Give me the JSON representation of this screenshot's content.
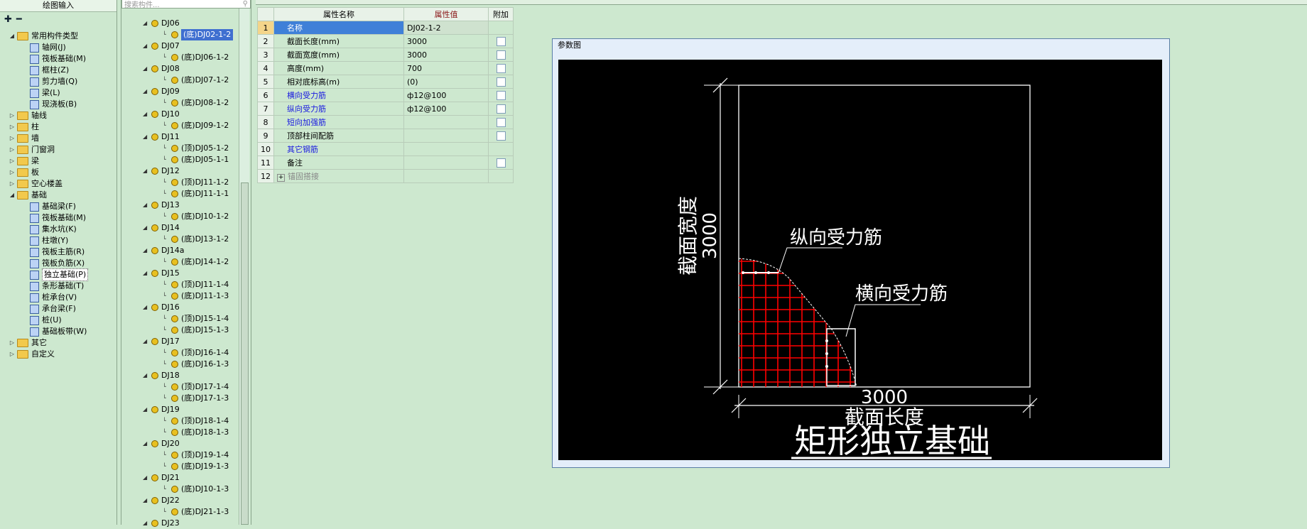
{
  "left": {
    "title": "绘图输入",
    "tree": [
      {
        "level": 0,
        "exp": "◢",
        "type": "folder",
        "label": "常用构件类型"
      },
      {
        "level": 1,
        "type": "icon",
        "label": "轴网(J)"
      },
      {
        "level": 1,
        "type": "icon",
        "label": "筏板基础(M)"
      },
      {
        "level": 1,
        "type": "icon",
        "label": "框柱(Z)"
      },
      {
        "level": 1,
        "type": "icon",
        "label": "剪力墙(Q)"
      },
      {
        "level": 1,
        "type": "icon",
        "label": "梁(L)"
      },
      {
        "level": 1,
        "type": "icon",
        "label": "现浇板(B)"
      },
      {
        "level": 0,
        "exp": "▷",
        "type": "folder",
        "label": "轴线"
      },
      {
        "level": 0,
        "exp": "▷",
        "type": "folder",
        "label": "柱"
      },
      {
        "level": 0,
        "exp": "▷",
        "type": "folder",
        "label": "墙"
      },
      {
        "level": 0,
        "exp": "▷",
        "type": "folder",
        "label": "门窗洞"
      },
      {
        "level": 0,
        "exp": "▷",
        "type": "folder",
        "label": "梁"
      },
      {
        "level": 0,
        "exp": "▷",
        "type": "folder",
        "label": "板"
      },
      {
        "level": 0,
        "exp": "▷",
        "type": "folder",
        "label": "空心楼盖"
      },
      {
        "level": 0,
        "exp": "◢",
        "type": "folder",
        "label": "基础"
      },
      {
        "level": 1,
        "type": "icon",
        "label": "基础梁(F)"
      },
      {
        "level": 1,
        "type": "icon",
        "label": "筏板基础(M)"
      },
      {
        "level": 1,
        "type": "icon",
        "label": "集水坑(K)"
      },
      {
        "level": 1,
        "type": "icon",
        "label": "柱墩(Y)"
      },
      {
        "level": 1,
        "type": "icon",
        "label": "筏板主筋(R)"
      },
      {
        "level": 1,
        "type": "icon",
        "label": "筏板负筋(X)"
      },
      {
        "level": 1,
        "type": "icon",
        "label": "独立基础(P)",
        "selected": true
      },
      {
        "level": 1,
        "type": "icon",
        "label": "条形基础(T)"
      },
      {
        "level": 1,
        "type": "icon",
        "label": "桩承台(V)"
      },
      {
        "level": 1,
        "type": "icon",
        "label": "承台梁(F)"
      },
      {
        "level": 1,
        "type": "icon",
        "label": "桩(U)"
      },
      {
        "level": 1,
        "type": "icon",
        "label": "基础板带(W)"
      },
      {
        "level": 0,
        "exp": "▷",
        "type": "folder",
        "label": "其它"
      },
      {
        "level": 0,
        "exp": "▷",
        "type": "folder",
        "label": "自定义"
      }
    ]
  },
  "middle": {
    "search_placeholder": "搜索构件...",
    "items": [
      {
        "level": 0,
        "label": "DJ06"
      },
      {
        "level": 1,
        "label": "(底)DJ02-1-2",
        "selected": true
      },
      {
        "level": 0,
        "label": "DJ07"
      },
      {
        "level": 1,
        "label": "(底)DJ06-1-2"
      },
      {
        "level": 0,
        "label": "DJ08"
      },
      {
        "level": 1,
        "label": "(底)DJ07-1-2"
      },
      {
        "level": 0,
        "label": "DJ09"
      },
      {
        "level": 1,
        "label": "(底)DJ08-1-2"
      },
      {
        "level": 0,
        "label": "DJ10"
      },
      {
        "level": 1,
        "label": "(底)DJ09-1-2"
      },
      {
        "level": 0,
        "label": "DJ11"
      },
      {
        "level": 1,
        "label": "(顶)DJ05-1-2"
      },
      {
        "level": 1,
        "label": "(底)DJ05-1-1"
      },
      {
        "level": 0,
        "label": "DJ12"
      },
      {
        "level": 1,
        "label": "(顶)DJ11-1-2"
      },
      {
        "level": 1,
        "label": "(底)DJ11-1-1"
      },
      {
        "level": 0,
        "label": "DJ13"
      },
      {
        "level": 1,
        "label": "(底)DJ10-1-2"
      },
      {
        "level": 0,
        "label": "DJ14"
      },
      {
        "level": 1,
        "label": "(底)DJ13-1-2"
      },
      {
        "level": 0,
        "label": "DJ14a"
      },
      {
        "level": 1,
        "label": "(底)DJ14-1-2"
      },
      {
        "level": 0,
        "label": "DJ15"
      },
      {
        "level": 1,
        "label": "(顶)DJ11-1-4"
      },
      {
        "level": 1,
        "label": "(底)DJ11-1-3"
      },
      {
        "level": 0,
        "label": "DJ16"
      },
      {
        "level": 1,
        "label": "(顶)DJ15-1-4"
      },
      {
        "level": 1,
        "label": "(底)DJ15-1-3"
      },
      {
        "level": 0,
        "label": "DJ17"
      },
      {
        "level": 1,
        "label": "(顶)DJ16-1-4"
      },
      {
        "level": 1,
        "label": "(底)DJ16-1-3"
      },
      {
        "level": 0,
        "label": "DJ18"
      },
      {
        "level": 1,
        "label": "(顶)DJ17-1-4"
      },
      {
        "level": 1,
        "label": "(底)DJ17-1-3"
      },
      {
        "level": 0,
        "label": "DJ19"
      },
      {
        "level": 1,
        "label": "(顶)DJ18-1-4"
      },
      {
        "level": 1,
        "label": "(底)DJ18-1-3"
      },
      {
        "level": 0,
        "label": "DJ20"
      },
      {
        "level": 1,
        "label": "(顶)DJ19-1-4"
      },
      {
        "level": 1,
        "label": "(底)DJ19-1-3"
      },
      {
        "level": 0,
        "label": "DJ21"
      },
      {
        "level": 1,
        "label": "(底)DJ10-1-3"
      },
      {
        "level": 0,
        "label": "DJ22"
      },
      {
        "level": 1,
        "label": "(底)DJ21-1-3"
      },
      {
        "level": 0,
        "label": "DJ23"
      }
    ]
  },
  "props": {
    "headers": {
      "name": "属性名称",
      "value": "属性值",
      "extra": "附加"
    },
    "rows": [
      {
        "num": "1",
        "name": "名称",
        "value": "DJ02-1-2",
        "style": "blue",
        "check": false,
        "active": true
      },
      {
        "num": "2",
        "name": "截面长度(mm)",
        "value": "3000",
        "style": "",
        "check": true
      },
      {
        "num": "3",
        "name": "截面宽度(mm)",
        "value": "3000",
        "style": "",
        "check": true
      },
      {
        "num": "4",
        "name": "高度(mm)",
        "value": "700",
        "style": "",
        "check": true
      },
      {
        "num": "5",
        "name": "相对底标高(m)",
        "value": "(0)",
        "style": "",
        "check": true
      },
      {
        "num": "6",
        "name": "横向受力筋",
        "value": "ф12@100",
        "style": "blue",
        "check": true
      },
      {
        "num": "7",
        "name": "纵向受力筋",
        "value": "ф12@100",
        "style": "blue",
        "check": true
      },
      {
        "num": "8",
        "name": "短向加强筋",
        "value": "",
        "style": "blue",
        "check": true
      },
      {
        "num": "9",
        "name": "顶部柱间配筋",
        "value": "",
        "style": "",
        "check": true
      },
      {
        "num": "10",
        "name": "其它钢筋",
        "value": "",
        "style": "blue",
        "check": false
      },
      {
        "num": "11",
        "name": "备注",
        "value": "",
        "style": "",
        "check": true
      },
      {
        "num": "12",
        "name": "锚固搭接",
        "value": "",
        "style": "gray",
        "check": false,
        "expand": "+"
      }
    ]
  },
  "diagram": {
    "window_title": "参数图",
    "dim_width_value": "3000",
    "dim_width_label": "截面宽度",
    "dim_length_value": "3000",
    "dim_length_label": "截面长度",
    "label_longitudinal": "纵向受力筋",
    "label_transverse": "横向受力筋",
    "main_title": "矩形独立基础",
    "colors": {
      "background": "#000000",
      "lines": "#ffffff",
      "rebar": "#ff0000"
    }
  }
}
